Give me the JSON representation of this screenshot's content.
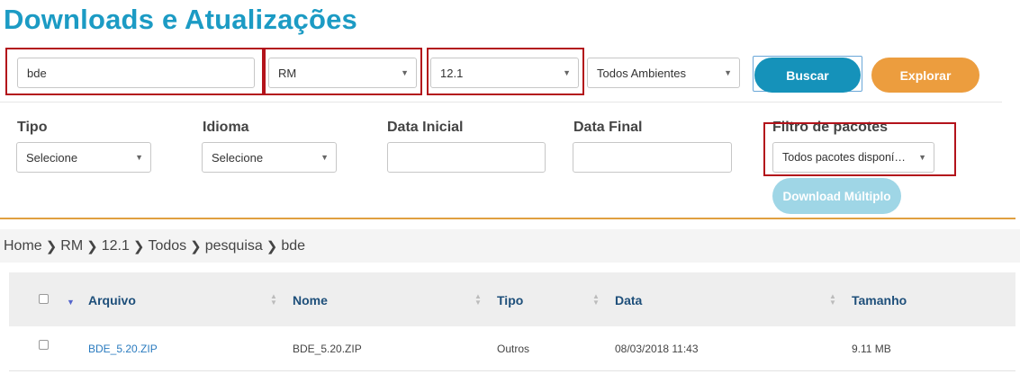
{
  "page": {
    "title": "Downloads e Atualizações"
  },
  "search": {
    "query": "bde",
    "product": "RM",
    "version": "12.1",
    "environment": "Todos Ambientes",
    "buscar_label": "Buscar",
    "explorar_label": "Explorar"
  },
  "filters": {
    "tipo": {
      "label": "Tipo",
      "value": "Selecione"
    },
    "idioma": {
      "label": "Idioma",
      "value": "Selecione"
    },
    "data_inicial": {
      "label": "Data Inicial",
      "value": ""
    },
    "data_final": {
      "label": "Data Final",
      "value": ""
    },
    "pacotes": {
      "label": "Filtro de pacotes",
      "value": "Todos pacotes disponí…"
    },
    "download_multiplo_label": "Download Múltiplo"
  },
  "breadcrumb": [
    "Home",
    "RM",
    "12.1",
    "Todos",
    "pesquisa",
    "bde"
  ],
  "table": {
    "columns": [
      "Arquivo",
      "Nome",
      "Tipo",
      "Data",
      "Tamanho"
    ],
    "rows": [
      {
        "arquivo": "BDE_5.20.ZIP",
        "nome": "BDE_5.20.ZIP",
        "tipo": "Outros",
        "data": "08/03/2018 11:43",
        "tamanho": "9.11 MB"
      }
    ]
  },
  "colors": {
    "accent": "#1c9bc4",
    "explorar": "#ec9d3e",
    "highlight": "#b3131b",
    "divider": "#e0a040"
  }
}
